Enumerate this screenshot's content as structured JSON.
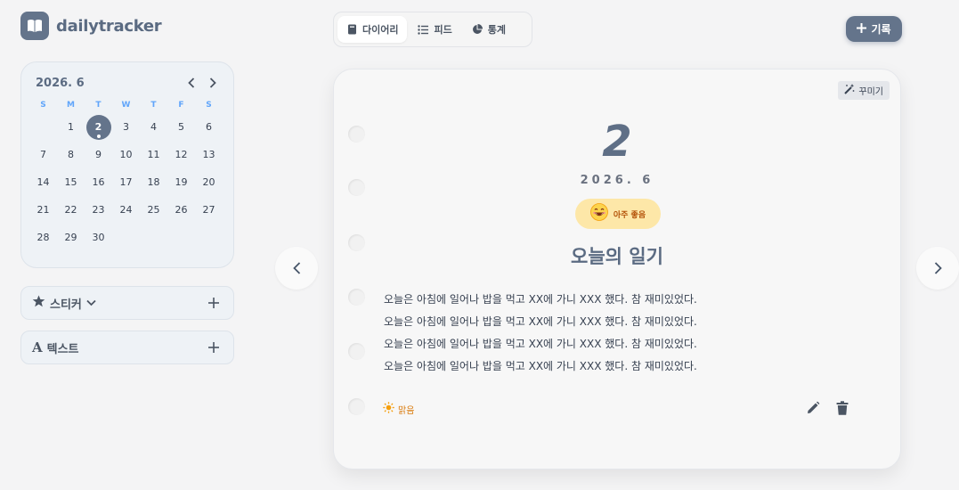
{
  "app": {
    "name": "dailytracker"
  },
  "tabs": [
    {
      "label": "다이어리",
      "icon": "book-icon"
    },
    {
      "label": "피드",
      "icon": "list-icon"
    },
    {
      "label": "통계",
      "icon": "pie-chart-icon"
    }
  ],
  "record_button": {
    "label": "기록",
    "icon": "plus-icon"
  },
  "calendar": {
    "month_label": "2026. 6",
    "weekdays": [
      "S",
      "M",
      "T",
      "W",
      "T",
      "F",
      "S"
    ],
    "weeks": [
      [
        "",
        "1",
        "2",
        "3",
        "4",
        "5",
        "6"
      ],
      [
        "7",
        "8",
        "9",
        "10",
        "11",
        "12",
        "13"
      ],
      [
        "14",
        "15",
        "16",
        "17",
        "18",
        "19",
        "20"
      ],
      [
        "21",
        "22",
        "23",
        "24",
        "25",
        "26",
        "27"
      ],
      [
        "28",
        "29",
        "30",
        "",
        "",
        "",
        ""
      ]
    ],
    "selected_day": "2"
  },
  "sticker_panel": {
    "label": "스티커",
    "icon": "star-icon"
  },
  "text_panel": {
    "label": "텍스트",
    "icon": "font-icon"
  },
  "diary": {
    "decorate_label": "꾸미기",
    "day": "2",
    "month_label": "2026. 6",
    "mood_label": "아주 좋음",
    "mood_emoji": "😄",
    "title": "오늘의 일기",
    "body": [
      "오늘은 아침에 일어나 밥을 먹고 XX에 가니 XXX 했다. 참 재미있었다.",
      "오늘은 아침에 일어나 밥을 먹고 XX에 가니 XXX 했다. 참 재미있었다.",
      "오늘은 아침에 일어나 밥을 먹고 XX에 가니 XXX 했다. 참 재미있었다.",
      "오늘은 아침에 일어나 밥을 먹고 XX에 가니 XXX 했다. 참 재미있었다."
    ],
    "weather_label": "맑음"
  },
  "colors": {
    "accent": "#64748b",
    "mood_bg": "#fde7a8",
    "weather": "#d97706",
    "weekday": "#60a5fa"
  }
}
